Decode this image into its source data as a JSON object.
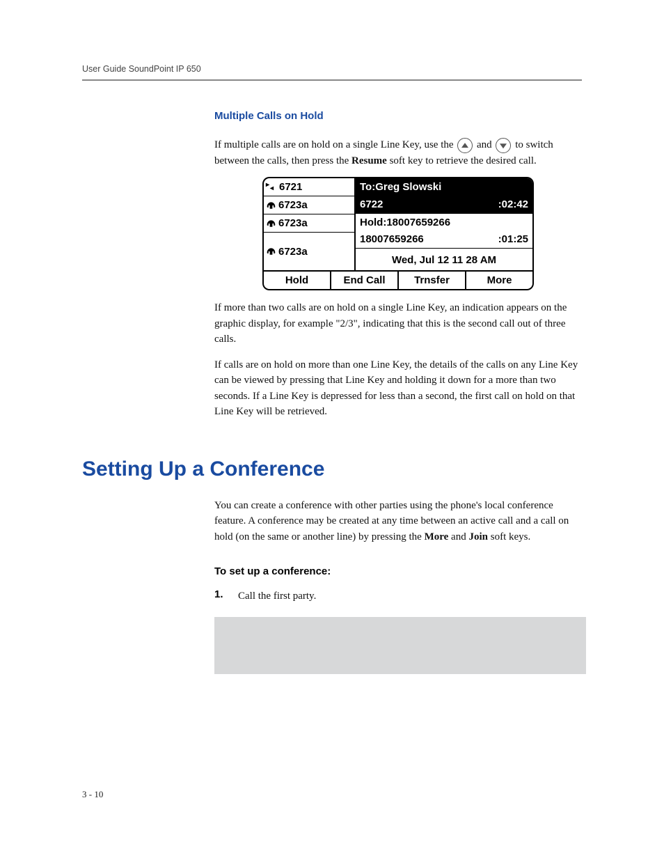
{
  "header": "User Guide SoundPoint IP 650",
  "section1": {
    "heading": "Multiple Calls on Hold",
    "p1_a": "If multiple calls are on hold on a single Line Key, use the ",
    "p1_b": " and ",
    "p1_c": " to switch between the calls, then press the ",
    "p1_bold": "Resume",
    "p1_d": " soft key to retrieve the desired call."
  },
  "phone": {
    "lines": [
      {
        "icon": "arrows",
        "label": "6721"
      },
      {
        "icon": "phone",
        "label": "6723a"
      },
      {
        "icon": "phone",
        "label": "6723a"
      },
      {
        "icon": "phone",
        "label": "6723a"
      }
    ],
    "call_to": "To:Greg Slowski",
    "call_active_num": "6722",
    "call_active_time": ":02:42",
    "hold_label": "Hold:18007659266",
    "hold_num": "18007659266",
    "hold_time": ":01:25",
    "datetime": "Wed, Jul 12  11 28 AM",
    "softkeys": [
      "Hold",
      "End Call",
      "Trnsfer",
      "More"
    ]
  },
  "section1_after": {
    "p2": "If more than two calls are on hold on a single Line Key, an indication appears on the graphic display, for example \"2/3\", indicating that this is the second call out of three calls.",
    "p3": "If calls are on hold on more than one Line Key, the details of the calls on any Line Key can be viewed by pressing that Line Key and holding it down for a more than two seconds. If a Line Key is depressed for less than a second, the first call on hold on that Line Key will be retrieved."
  },
  "section2": {
    "heading": "Setting Up a Conference",
    "p1_a": "You can create a conference with other parties using the phone's local conference feature. A conference may be created at any time between an active call and a call on hold (on the same or another line) by pressing the ",
    "p1_more": "More",
    "p1_b": " and ",
    "p1_join": "Join",
    "p1_c": " soft keys.",
    "steps_title": "To set up a conference:",
    "step1_num": "1.",
    "step1_text": "Call the first party."
  },
  "page_number": "3 - 10"
}
